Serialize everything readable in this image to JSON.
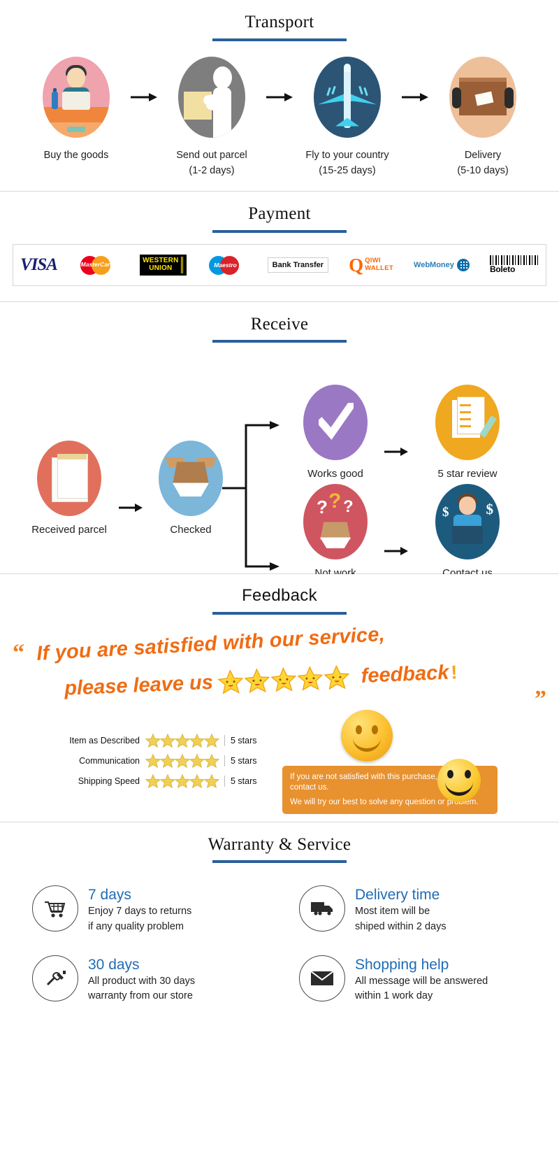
{
  "sections": {
    "transport": {
      "title": "Transport",
      "steps": [
        {
          "icon": "buyer-at-desk-icon",
          "label": "Buy the goods",
          "sub": ""
        },
        {
          "icon": "warehouse-packer-icon",
          "label": "Send out parcel",
          "sub": "(1-2 days)"
        },
        {
          "icon": "airplane-icon",
          "label": "Fly to your country",
          "sub": "(15-25 days)"
        },
        {
          "icon": "parcel-handover-icon",
          "label": "Delivery",
          "sub": "(5-10 days)"
        }
      ],
      "arrow": "arrow-right-icon"
    },
    "payment": {
      "title": "Payment",
      "methods": [
        {
          "name": "visa-logo",
          "label": "VISA"
        },
        {
          "name": "mastercard-logo",
          "label": "MasterCard"
        },
        {
          "name": "western-union-logo",
          "label_line1": "WESTERN",
          "label_line2": "UNION"
        },
        {
          "name": "maestro-logo",
          "label": "Maestro"
        },
        {
          "name": "bank-transfer-logo",
          "label": "Bank Transfer"
        },
        {
          "name": "qiwi-wallet-logo",
          "label_line1": "QIWI",
          "label_line2": "WALLET",
          "mark": "Q"
        },
        {
          "name": "webmoney-logo",
          "label": "WebMoney"
        },
        {
          "name": "boleto-logo",
          "label": "Boleto"
        }
      ]
    },
    "receive": {
      "title": "Receive",
      "nodes": [
        {
          "icon": "received-parcel-icon",
          "label": "Received parcel"
        },
        {
          "icon": "opened-box-icon",
          "label": "Checked"
        },
        {
          "icon": "checkmark-icon",
          "label": "Works good"
        },
        {
          "icon": "question-box-icon",
          "label": "Not work"
        },
        {
          "icon": "review-form-icon",
          "label": "5 star review"
        },
        {
          "icon": "support-agent-icon",
          "label": "Contact us"
        }
      ]
    },
    "feedback": {
      "title": "Feedback",
      "slogan_line1": "If you are satisfied with our service,",
      "slogan_line2_pre": "please leave us",
      "slogan_line2_word": "feedback",
      "slogan_line2_bang": "!",
      "quote_open": "“",
      "quote_close": "”",
      "star_count": 5,
      "ratings": [
        {
          "name": "Item as Described",
          "stars": 5,
          "value": "5 stars"
        },
        {
          "name": "Communication",
          "stars": 5,
          "value": "5 stars"
        },
        {
          "name": "Shipping Speed",
          "stars": 5,
          "value": "5 stars"
        }
      ],
      "callout_line1": "If you are not satisfied with this purchase, please contact us.",
      "callout_line2": "We will try our best to solve any question or problem.",
      "smiley_icon": "smiley-face-icon"
    },
    "warranty": {
      "title": "Warranty & Service",
      "cards": [
        {
          "icon": "shopping-cart-icon",
          "head": "7 days",
          "body_line1": "Enjoy 7 days to returns",
          "body_line2": "if any quality problem"
        },
        {
          "icon": "delivery-truck-icon",
          "head": "Delivery time",
          "body_line1": "Most item will be",
          "body_line2": "shiped within 2 days"
        },
        {
          "icon": "tools-icon",
          "head": "30 days",
          "body_line1": "All product with 30 days",
          "body_line2": "warranty from our store"
        },
        {
          "icon": "envelope-icon",
          "head": "Shopping help",
          "body_line1": "All message will be answered",
          "body_line2": "within 1 work day"
        }
      ]
    }
  },
  "colors": {
    "rule_blue": "#2a6099",
    "heading_blue": "#1f6cb4",
    "slogan_orange": "#ef6c13",
    "callout_orange": "#e8912f",
    "star_yellow": "#f5c518"
  }
}
